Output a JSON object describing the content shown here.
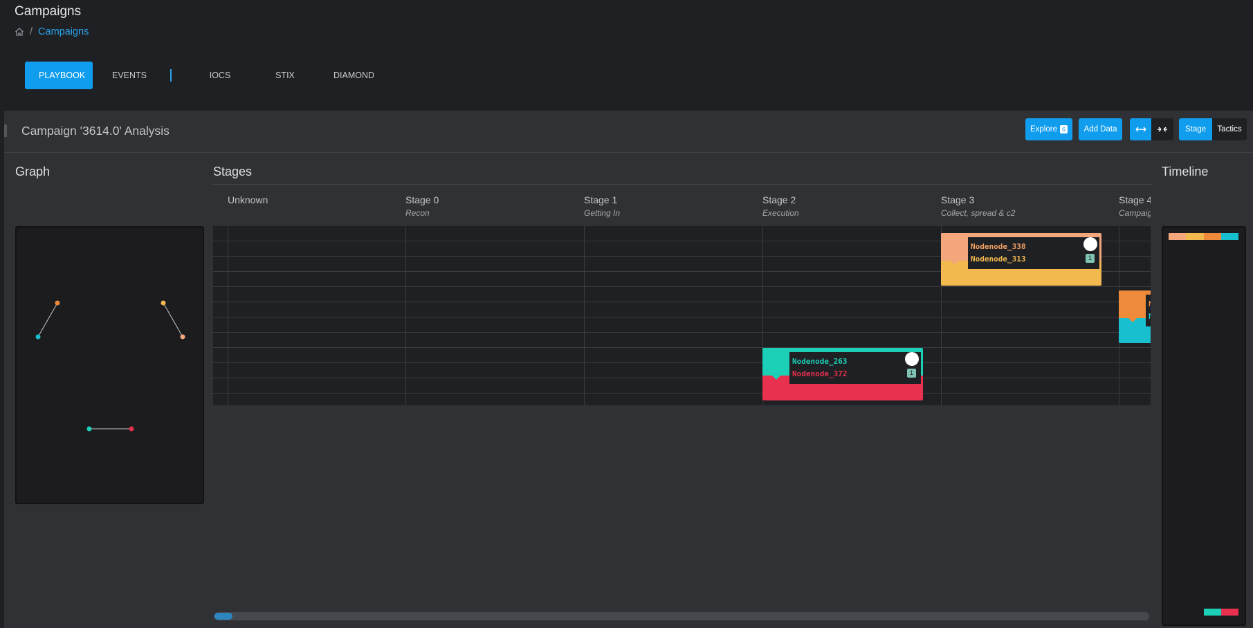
{
  "header": {
    "title": "Campaigns",
    "breadcrumb": {
      "current": "Campaigns"
    }
  },
  "tabs": [
    {
      "label": "PLAYBOOK",
      "active": true
    },
    {
      "label": "EVENTS"
    },
    {
      "label": "IOCS"
    },
    {
      "label": "STIX"
    },
    {
      "label": "DIAMOND"
    }
  ],
  "analysis": {
    "title": "Campaign '3614.0' Analysis",
    "explore_label": "Explore",
    "explore_count": "6",
    "add_data_label": "Add Data",
    "expand_icon": "↔",
    "collapse_icon": "⇥⇤",
    "view_stage_label": "Stage",
    "view_tactics_label": "Tactics"
  },
  "sections": {
    "graph": "Graph",
    "stages": "Stages",
    "timeline": "Timeline"
  },
  "stages": [
    {
      "name": "Unknown",
      "sub": ""
    },
    {
      "name": "Stage 0",
      "sub": "Recon"
    },
    {
      "name": "Stage 1",
      "sub": "Getting In"
    },
    {
      "name": "Stage 2",
      "sub": "Execution"
    },
    {
      "name": "Stage 3",
      "sub": "Collect, spread & c2"
    },
    {
      "name": "Stage 4",
      "sub": "Campaig"
    }
  ],
  "cards": [
    {
      "line1": "Nodenode_338",
      "line2": "Nodenode_313",
      "count": "1",
      "colors": {
        "top": "#f5a77c",
        "bottom": "#f2b94f",
        "text1": "#f0a064",
        "text2": "#f2b94f"
      }
    },
    {
      "line1": "Nodenode_263",
      "line2": "Nodenode_372",
      "count": "1",
      "colors": {
        "top": "#1ccfb7",
        "bottom": "#e8304f",
        "text1": "#1ccfb7",
        "text2": "#e8304f"
      }
    },
    {
      "line1": "N",
      "line2": "N",
      "colors": {
        "top": "#ee8a3a",
        "bottom": "#18bfcf"
      }
    }
  ],
  "graph": {
    "colors": {
      "teal": "#18bfcf",
      "orange": "#ee8a3a",
      "amber": "#f2b94f",
      "salmon": "#f5a77c",
      "green": "#1ccfb7",
      "red": "#e8304f"
    }
  },
  "icons": {
    "home": "home-icon"
  }
}
